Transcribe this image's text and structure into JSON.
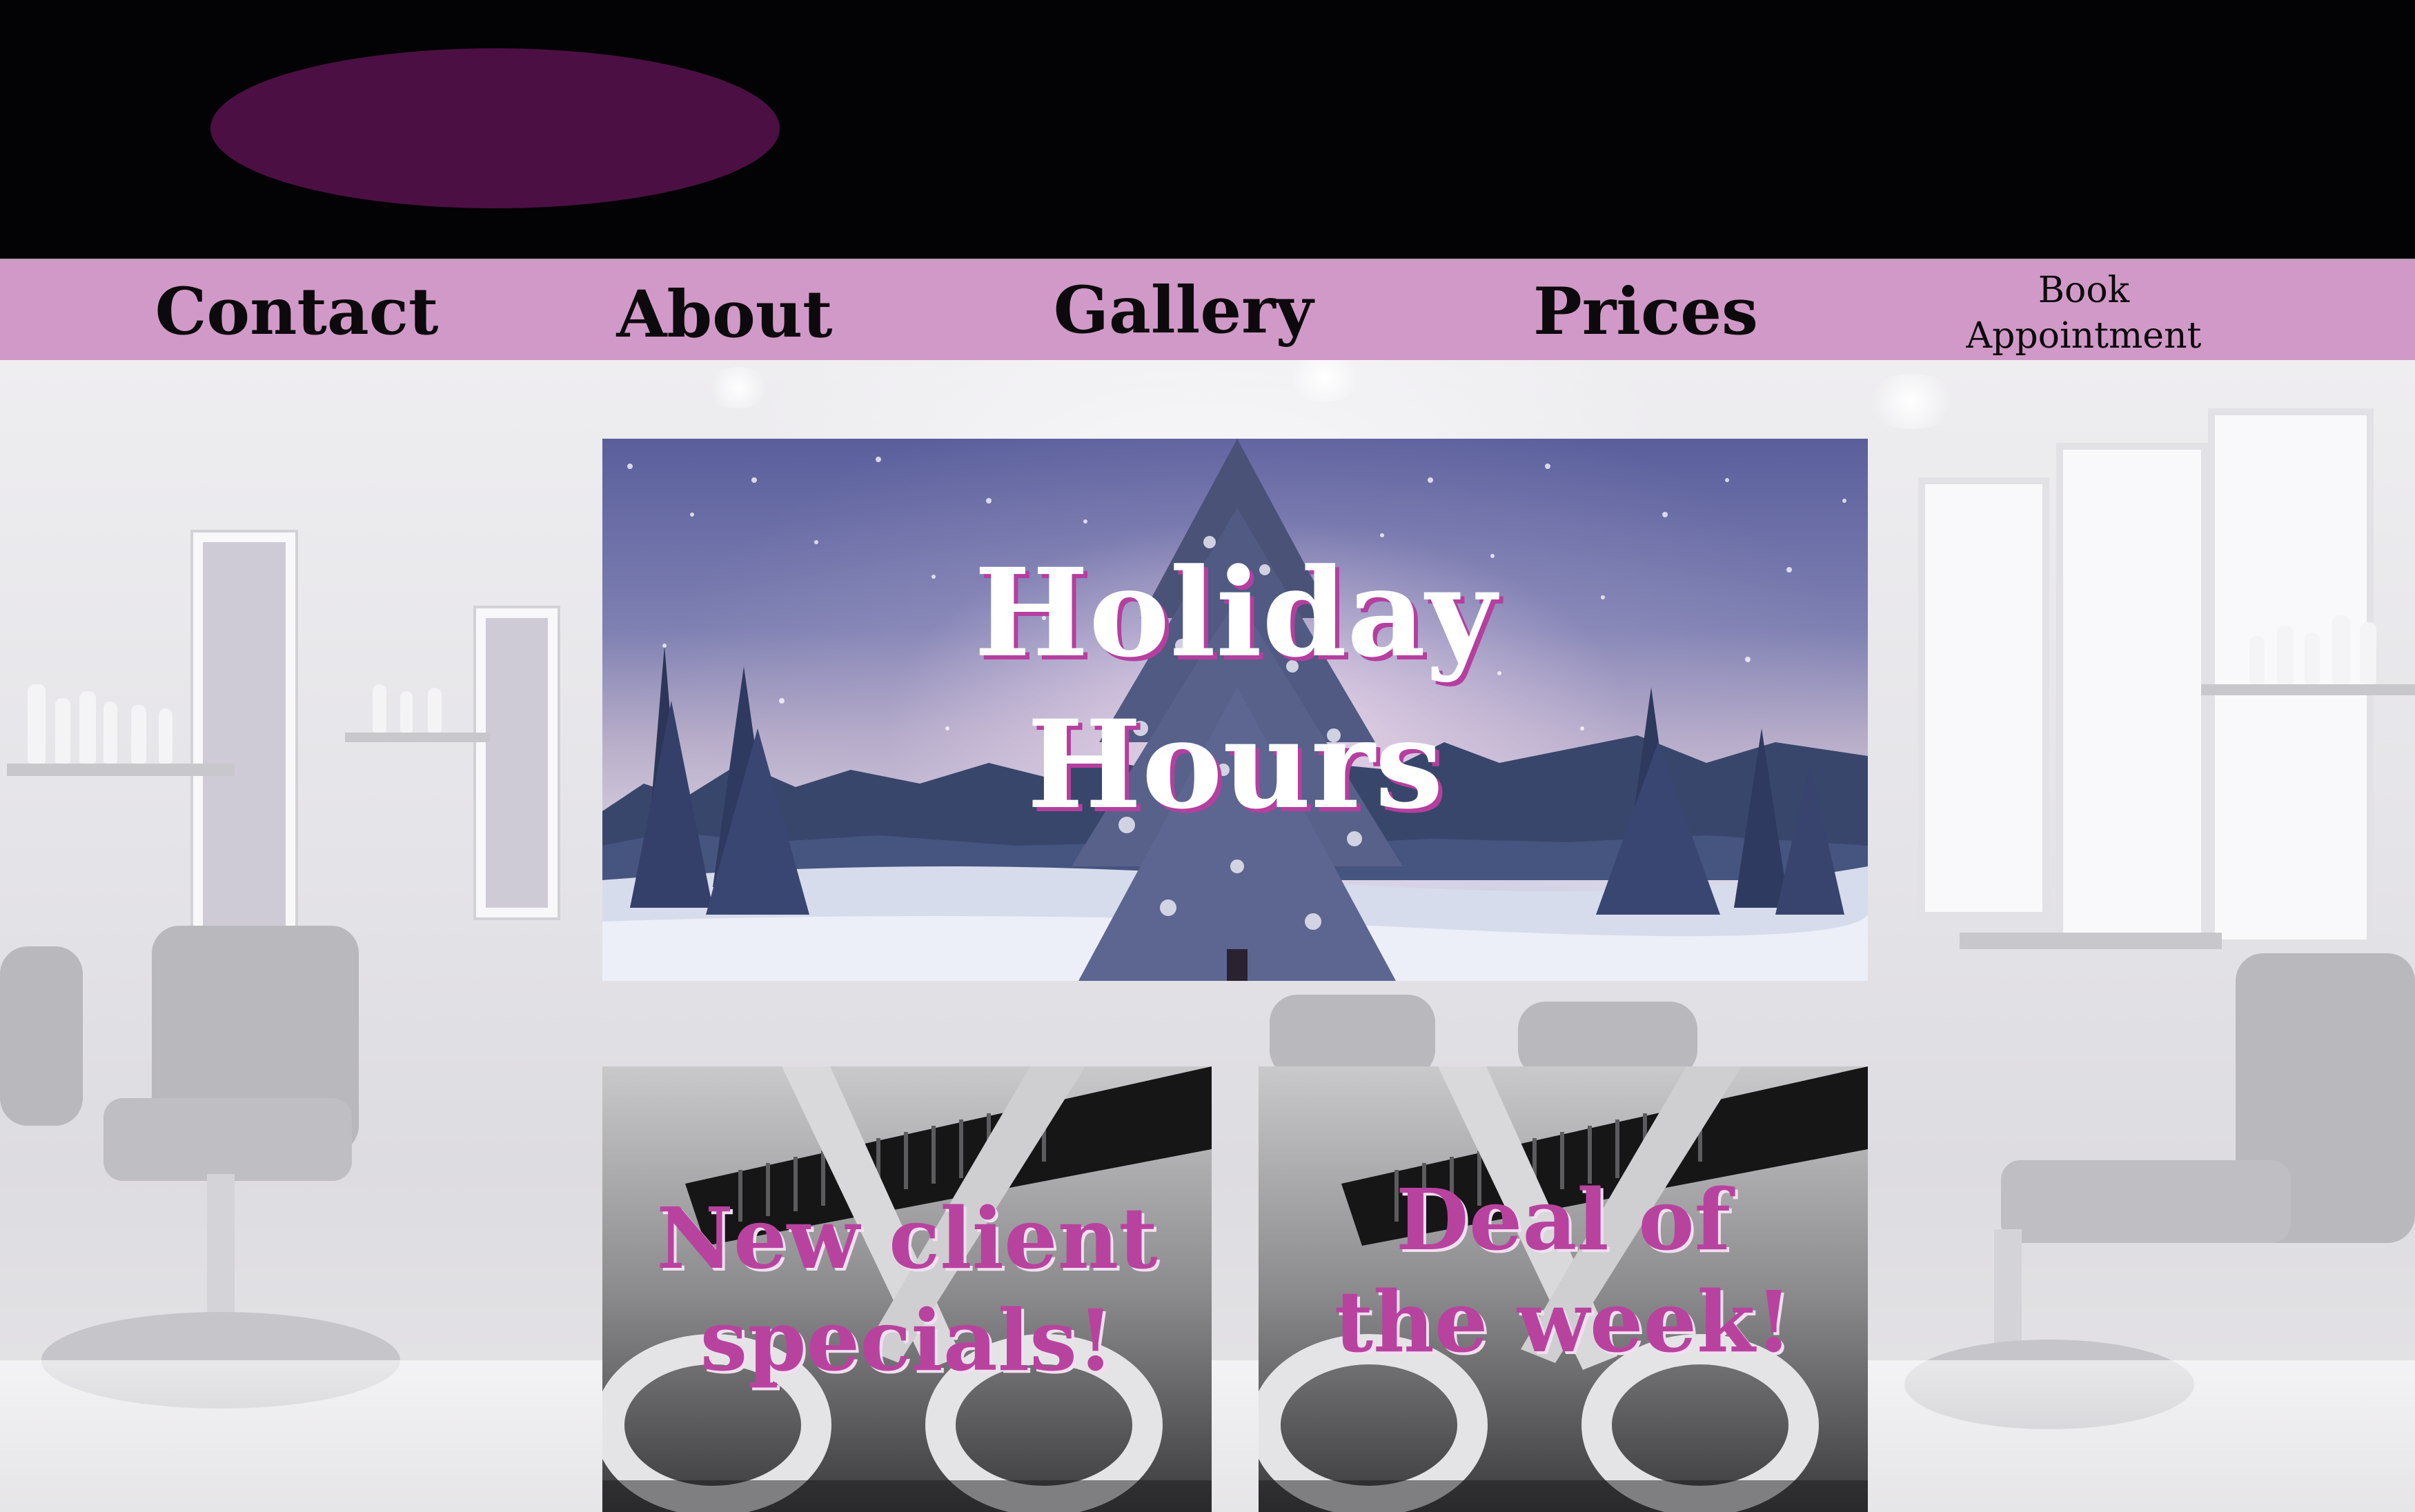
{
  "header": {
    "logo": "oval-logo-placeholder"
  },
  "nav": {
    "contact": "Contact",
    "about": "About",
    "gallery": "Gallery",
    "prices": "Prices",
    "book_line1": "Book",
    "book_line2": "Appointment"
  },
  "banner": {
    "line1": "Holiday",
    "line2": "Hours"
  },
  "promos": [
    {
      "line1": "New client",
      "line2": "specials!"
    },
    {
      "line1": "Deal of",
      "line2": "the week!"
    }
  ],
  "colors": {
    "header_bg": "#030204",
    "logo": "#4b0f43",
    "nav_bg": "#d199c8",
    "banner_text": "#ffffff",
    "banner_shadow": "#b53f9f",
    "promo_text": "#b8439f"
  }
}
